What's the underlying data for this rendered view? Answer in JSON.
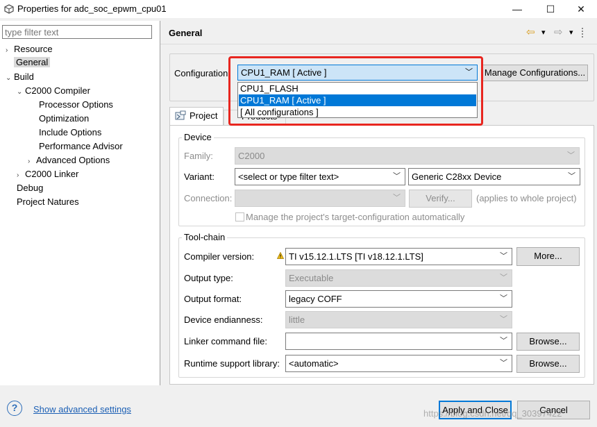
{
  "window": {
    "title": "Properties for adc_soc_epwm_cpu01",
    "minimize_glyph": "—",
    "maximize_glyph": "☐",
    "close_glyph": "✕"
  },
  "left_panel": {
    "filter_placeholder": "type filter text",
    "tree": [
      {
        "label": "Resource",
        "toggle": "›"
      },
      {
        "label": "General",
        "toggle": ""
      },
      {
        "label": "Build",
        "toggle": "⌄"
      },
      {
        "label": "C2000 Compiler",
        "toggle": "⌄"
      },
      {
        "label": "Processor Options",
        "toggle": ""
      },
      {
        "label": "Optimization",
        "toggle": ""
      },
      {
        "label": "Include Options",
        "toggle": ""
      },
      {
        "label": "Performance Advisor",
        "toggle": ""
      },
      {
        "label": "Advanced Options",
        "toggle": "›"
      },
      {
        "label": "C2000 Linker",
        "toggle": "›"
      },
      {
        "label": "Debug",
        "toggle": ""
      },
      {
        "label": "Project Natures",
        "toggle": ""
      }
    ]
  },
  "page": {
    "title": "General",
    "nav": {
      "back_glyph": "⇦",
      "forward_glyph": "⇨",
      "dropdown_glyph": "▾"
    }
  },
  "configuration": {
    "label": "Configuration:",
    "selected": "CPU1_RAM  [ Active ]",
    "manage_button": "Manage Configurations...",
    "options": [
      "CPU1_FLASH",
      "CPU1_RAM  [ Active ]",
      "[ All configurations ]"
    ],
    "selected_index": 1
  },
  "tabs": {
    "project": "Project",
    "products": "Products"
  },
  "device": {
    "title": "Device",
    "family_label": "Family:",
    "family_value": "C2000",
    "variant_label": "Variant:",
    "variant_filter": "<select or type filter text>",
    "variant_value": "Generic C28xx Device",
    "connection_label": "Connection:",
    "connection_value": "",
    "verify_button": "Verify...",
    "connection_note": "(applies to whole project)",
    "manage_target_checkbox": "Manage the project's target-configuration automatically"
  },
  "toolchain": {
    "title": "Tool-chain",
    "compiler_version_label": "Compiler version:",
    "compiler_version_value": "TI v15.12.1.LTS  [TI v18.12.1.LTS]",
    "more_button": "More...",
    "output_type_label": "Output type:",
    "output_type_value": "Executable",
    "output_format_label": "Output format:",
    "output_format_value": "legacy COFF",
    "endianness_label": "Device endianness:",
    "endianness_value": "little",
    "linker_cmd_label": "Linker command file:",
    "linker_cmd_value": "",
    "browse_button": "Browse...",
    "runtime_lib_label": "Runtime support library:",
    "runtime_lib_value": "<automatic>",
    "browse_button_2": "Browse..."
  },
  "footer": {
    "help_glyph": "?",
    "advanced_link": "Show advanced settings",
    "apply_button": "Apply and Close",
    "cancel_button": "Cancel"
  },
  "watermark": "https://blog.csdn.net/qq_30397422",
  "colors": {
    "accent": "#0078d7",
    "highlight": "#e8261f",
    "selection": "#cce4f7",
    "link": "#1b5fb4"
  }
}
